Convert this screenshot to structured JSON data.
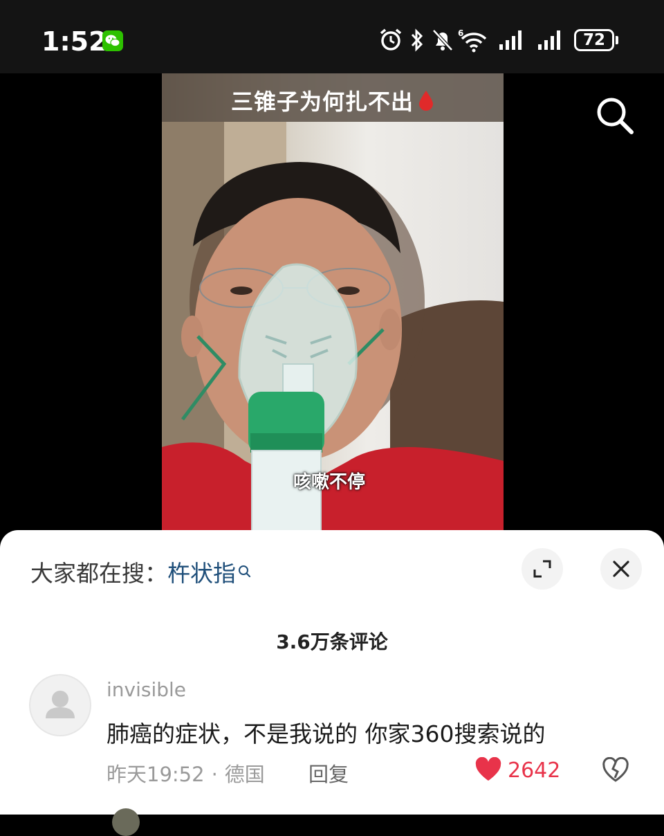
{
  "status_bar": {
    "time": "1:52",
    "battery": "72",
    "icons": [
      "wechat-icon",
      "alarm-icon",
      "bluetooth-icon",
      "mute-icon",
      "wifi-icon",
      "signal-icon",
      "signal-icon",
      "battery-icon"
    ]
  },
  "video": {
    "title": "三锥子为何扎不出",
    "caption": "咳嗽不停"
  },
  "panel": {
    "hot_search_label": "大家都在搜：",
    "hot_search_term": "杵状指",
    "comment_count": "3.6万条评论"
  },
  "comments": [
    {
      "username": "invisible",
      "text": "肺癌的症状，不是我说的 你家360搜索说的",
      "time": "昨天19:52",
      "location": "德国",
      "reply_label": "回复",
      "likes": "2642",
      "liked": true
    }
  ],
  "colors": {
    "accent_like": "#e8334a",
    "hot_search_term": "#1f4f7a",
    "wechat_green": "#2dc100"
  }
}
